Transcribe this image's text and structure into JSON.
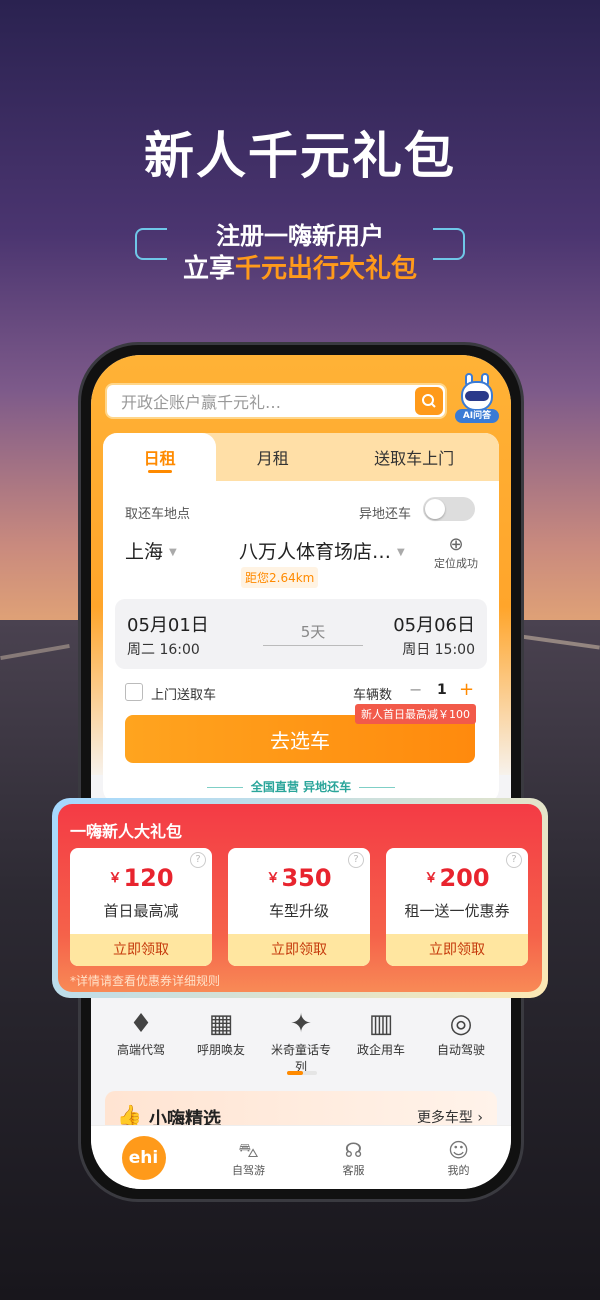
{
  "promo": {
    "headline": "新人千元礼包",
    "line1": "注册一嗨新用户",
    "line2_prefix": "立享",
    "line2_highlight": "千元出行大礼包"
  },
  "search": {
    "placeholder": "开政企账户赢千元礼…"
  },
  "ai_assistant": {
    "label": "AI问答"
  },
  "rental_tabs": [
    "日租",
    "月租",
    "送取车上门"
  ],
  "booking": {
    "pickup_label": "取还车地点",
    "diff_return_label": "异地还车",
    "city": "上海",
    "store": "八万人体育场店…",
    "distance": "距您2.64km",
    "locate_label": "定位成功",
    "start_date": "05月01日",
    "start_time": "周二 16:00",
    "duration": "5天",
    "end_date": "05月06日",
    "end_time": "周日 15:00",
    "door_service_label": "上门送取车",
    "car_count_label": "车辆数",
    "car_count": "1",
    "minus": "−",
    "plus": "+",
    "promo_tag": "新人首日最高减￥100",
    "go_button": "去选车",
    "footnote": "全国直营  异地还车"
  },
  "gift_pack": {
    "title": "一嗨新人大礼包",
    "coupons": [
      {
        "currency": "￥",
        "amount": "120",
        "desc": "首日最高减",
        "action": "立即领取"
      },
      {
        "currency": "￥",
        "amount": "350",
        "desc": "车型升级",
        "action": "立即领取"
      },
      {
        "currency": "￥",
        "amount": "200",
        "desc": "租一送一优惠券",
        "action": "立即领取"
      }
    ],
    "help_mark": "?",
    "note": "*详情请查看优惠券详细规则"
  },
  "quick_links": [
    {
      "icon": "tie-icon",
      "glyph": "♦",
      "label": "高端代驾"
    },
    {
      "icon": "gift-box-icon",
      "glyph": "▦",
      "label": "呼朋唤友"
    },
    {
      "icon": "disney-logo-icon",
      "glyph": "✦",
      "label": "米奇童话专列"
    },
    {
      "icon": "building-icon",
      "glyph": "▥",
      "label": "政企用车"
    },
    {
      "icon": "autodrive-icon",
      "glyph": "◎",
      "label": "自动驾驶"
    }
  ],
  "picks": {
    "title": "小嗨精选",
    "more": "更多车型 ›"
  },
  "tab_bar": [
    {
      "icon": "ehi-home-icon",
      "label": "ehi"
    },
    {
      "icon": "car-icon",
      "glyph": "⛍",
      "label": "自驾游"
    },
    {
      "icon": "headset-icon",
      "glyph": "☊",
      "label": "客服"
    },
    {
      "icon": "profile-icon",
      "glyph": "☺",
      "label": "我的"
    }
  ],
  "colors": {
    "accent": "#ff9a1a",
    "gift_red": "#f43b45",
    "teal": "#2aa59a"
  }
}
